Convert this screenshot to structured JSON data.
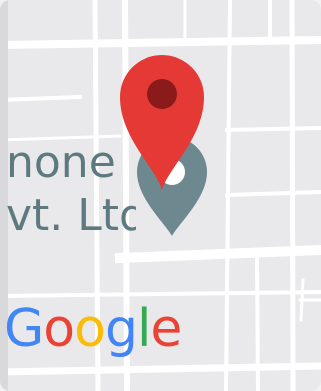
{
  "map": {
    "place_label": {
      "line1": "none",
      "line2": "vt. Ltd"
    },
    "logo": {
      "letters": [
        "G",
        "o",
        "o",
        "g",
        "l",
        "e"
      ]
    },
    "markers": [
      {
        "name": "selected-location-pin",
        "color": "#e53935",
        "dot_color": "#8b1a1a"
      },
      {
        "name": "place-pin",
        "color": "#6e8890"
      }
    ],
    "colors": {
      "land": "#e9e9eb",
      "road": "#ffffff",
      "logo": [
        "#4285f4",
        "#ea4335",
        "#fbbc05",
        "#4285f4",
        "#34a853",
        "#ea4335"
      ]
    }
  }
}
